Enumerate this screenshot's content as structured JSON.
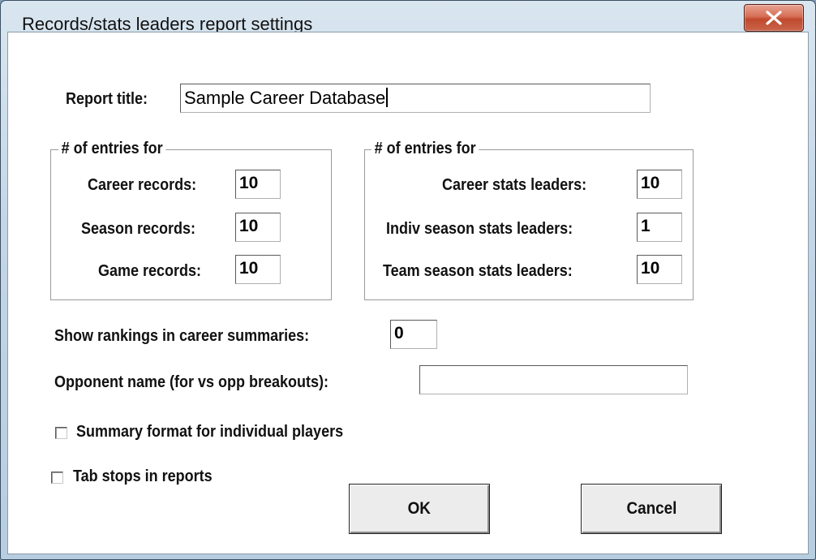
{
  "window": {
    "title": "Records/stats leaders report settings",
    "close_icon": "close-x-icon"
  },
  "form": {
    "report_title_label": "Report title:",
    "report_title_value": "Sample Career Database",
    "left_group": {
      "legend": "# of entries for",
      "career_records_label": "Career records:",
      "career_records_value": "10",
      "season_records_label": "Season records:",
      "season_records_value": "10",
      "game_records_label": "Game records:",
      "game_records_value": "10"
    },
    "right_group": {
      "legend": "# of entries for",
      "career_stats_label": "Career stats leaders:",
      "career_stats_value": "10",
      "indiv_season_label": "Indiv season stats leaders:",
      "indiv_season_value": "1",
      "team_season_label": "Team season stats leaders:",
      "team_season_value": "10"
    },
    "show_rankings_label": "Show rankings in career summaries:",
    "show_rankings_value": "0",
    "opponent_label": "Opponent name (for vs opp breakouts):",
    "opponent_value": "",
    "summary_format_label": "Summary format for individual players",
    "summary_format_checked": false,
    "tab_stops_label": "Tab stops in reports",
    "tab_stops_checked": false
  },
  "buttons": {
    "ok_label": "OK",
    "cancel_label": "Cancel"
  },
  "colors": {
    "title_bar": "#c4d6e6",
    "close_button": "#c9644a",
    "client_background": "#ffffff"
  }
}
